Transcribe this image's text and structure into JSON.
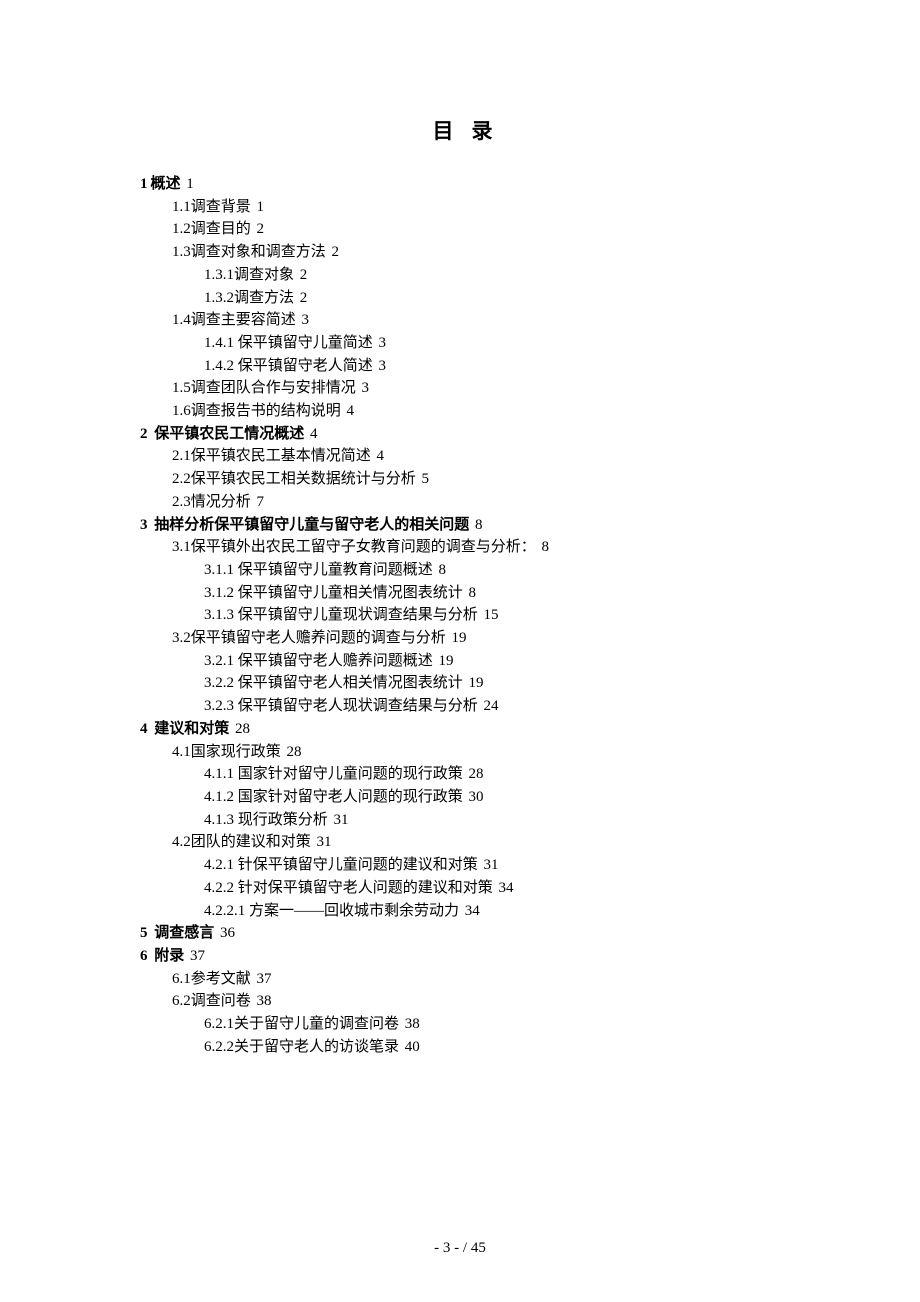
{
  "title": "目录",
  "entries": [
    {
      "level": 1,
      "num": "1",
      "label": "概述",
      "page": "1"
    },
    {
      "level": 2,
      "num": "1.1",
      "label": "调查背景",
      "page": "1"
    },
    {
      "level": 2,
      "num": "1.2",
      "label": "调查目的",
      "page": "2"
    },
    {
      "level": 2,
      "num": "1.3",
      "label": "调查对象和调查方法",
      "page": "2"
    },
    {
      "level": 3,
      "num": "1.3.1",
      "label": "调查对象",
      "page": "2"
    },
    {
      "level": 3,
      "num": "1.3.2",
      "label": "调查方法",
      "page": "2"
    },
    {
      "level": 2,
      "num": "1.4",
      "label": "调查主要容简述",
      "page": "3"
    },
    {
      "level": 3,
      "num": "1.4.1",
      "label": " 保平镇留守儿童简述",
      "page": "3"
    },
    {
      "level": 3,
      "num": "1.4.2",
      "label": " 保平镇留守老人简述",
      "page": "3"
    },
    {
      "level": 2,
      "num": "1.5",
      "label": "调查团队合作与安排情况",
      "page": "3"
    },
    {
      "level": 2,
      "num": "1.6",
      "label": "调查报告书的结构说明",
      "page": "4"
    },
    {
      "level": 1,
      "num": "2",
      "label": " 保平镇农民工情况概述",
      "page": "4"
    },
    {
      "level": 2,
      "num": "2.1",
      "label": "保平镇农民工基本情况简述",
      "page": "4"
    },
    {
      "level": 2,
      "num": "2.2",
      "label": "保平镇农民工相关数据统计与分析",
      "page": "5"
    },
    {
      "level": 2,
      "num": "2.3",
      "label": "情况分析",
      "page": "7"
    },
    {
      "level": 1,
      "num": "3",
      "label": " 抽样分析保平镇留守儿童与留守老人的相关问题",
      "page": "8"
    },
    {
      "level": 2,
      "num": "3.1",
      "label": "保平镇外出农民工留守子女教育问题的调查与分析：",
      "page": "8"
    },
    {
      "level": 3,
      "num": "3.1.1",
      "label": " 保平镇留守儿童教育问题概述",
      "page": "8"
    },
    {
      "level": 3,
      "num": "3.1.2",
      "label": " 保平镇留守儿童相关情况图表统计",
      "page": "8"
    },
    {
      "level": 3,
      "num": "3.1.3",
      "label": " 保平镇留守儿童现状调查结果与分析",
      "page": "15"
    },
    {
      "level": 2,
      "num": "3.2",
      "label": "保平镇留守老人赡养问题的调查与分析",
      "page": "19"
    },
    {
      "level": 3,
      "num": "3.2.1",
      "label": " 保平镇留守老人赡养问题概述",
      "page": "19"
    },
    {
      "level": 3,
      "num": "3.2.2",
      "label": " 保平镇留守老人相关情况图表统计",
      "page": "19"
    },
    {
      "level": 3,
      "num": "3.2.3",
      "label": " 保平镇留守老人现状调查结果与分析",
      "page": "24"
    },
    {
      "level": 1,
      "num": "4",
      "label": " 建议和对策",
      "page": "28"
    },
    {
      "level": 2,
      "num": "4.1",
      "label": "国家现行政策",
      "page": "28"
    },
    {
      "level": 3,
      "num": "4.1.1",
      "label": " 国家针对留守儿童问题的现行政策",
      "page": "28"
    },
    {
      "level": 3,
      "num": "4.1.2",
      "label": " 国家针对留守老人问题的现行政策",
      "page": "30"
    },
    {
      "level": 3,
      "num": "4.1.3",
      "label": " 现行政策分析",
      "page": "31"
    },
    {
      "level": 2,
      "num": "4.2",
      "label": "团队的建议和对策",
      "page": "31"
    },
    {
      "level": 3,
      "num": "4.2.1",
      "label": " 针保平镇留守儿童问题的建议和对策",
      "page": "31"
    },
    {
      "level": 3,
      "num": "4.2.2",
      "label": " 针对保平镇留守老人问题的建议和对策",
      "page": "34"
    },
    {
      "level": 4,
      "num": "4.2.2.1",
      "label": " 方案一——回收城市剩余劳动力",
      "page": "34"
    },
    {
      "level": 1,
      "num": "5",
      "label": " 调查感言",
      "page": "36"
    },
    {
      "level": 1,
      "num": "6",
      "label": " 附录",
      "page": "37"
    },
    {
      "level": 2,
      "num": "6.1",
      "label": "参考文献",
      "page": "37"
    },
    {
      "level": 2,
      "num": "6.2",
      "label": "调查问卷",
      "page": "38"
    },
    {
      "level": 3,
      "num": "6.2.1",
      "label": "关于留守儿童的调查问卷",
      "page": "38"
    },
    {
      "level": 3,
      "num": "6.2.2",
      "label": "关于留守老人的访谈笔录",
      "page": "40"
    }
  ],
  "footer": "- 3 -  / 45"
}
